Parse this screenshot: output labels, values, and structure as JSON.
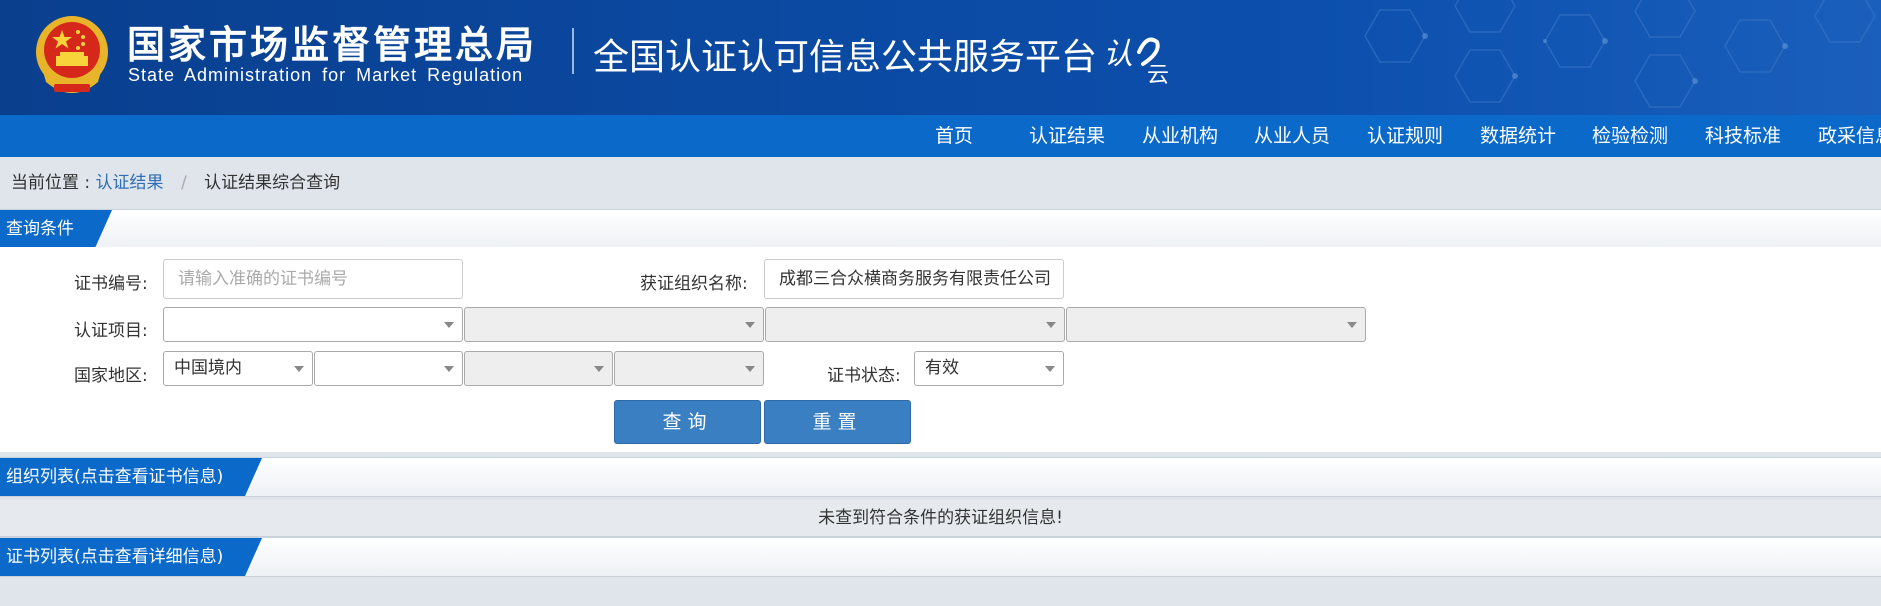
{
  "header": {
    "agency_cn": "国家市场监督管理总局",
    "agency_en": "State Administration for Market Regulation",
    "platform": "全国认证认可信息公共服务平台",
    "logo_text": "认云",
    "background_color": "#0b4aa3"
  },
  "nav": {
    "items": [
      "首页",
      "认证结果",
      "从业机构",
      "从业人员",
      "认证规则",
      "数据统计",
      "检验检测",
      "科技标准",
      "政采信息"
    ],
    "background_color": "#0a69c9"
  },
  "breadcrumb": {
    "prefix": "当前位置 :",
    "link": "认证结果",
    "separator": "/",
    "current": "认证结果综合查询"
  },
  "query": {
    "section_title": "查询条件",
    "cert_no_label": "证书编号:",
    "cert_no_placeholder": "请输入准确的证书编号",
    "org_name_label": "获证组织名称:",
    "org_name_value": "成都三合众横商务服务有限责任公司",
    "cert_item_label": "认证项目:",
    "region_label": "国家地区:",
    "region_value": "中国境内",
    "status_label": "证书状态:",
    "status_value": "有效",
    "query_button": "查询",
    "reset_button": "重置"
  },
  "org_list": {
    "section_title": "组织列表(点击查看证书信息)",
    "empty_text": "未查到符合条件的获证组织信息!"
  },
  "cert_list": {
    "section_title": "证书列表(点击查看详细信息)"
  },
  "colors": {
    "tab_blue": "#0a69c9",
    "button_blue": "#3a7fc2",
    "link_blue": "#2f6fb5"
  }
}
